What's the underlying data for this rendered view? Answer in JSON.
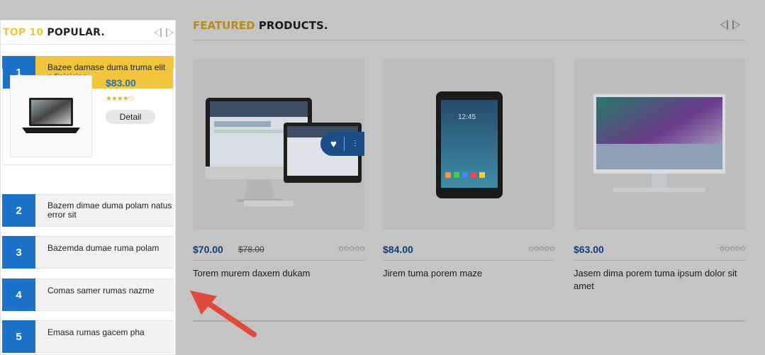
{
  "popular": {
    "title_accent": "TOP 10",
    "title_main": "POPULAR.",
    "items": [
      {
        "rank": "1",
        "label": "Bazee damase duma truma elit adipisicing"
      },
      {
        "rank": "2",
        "label": "Bazem dimae duma polam natus error sit"
      },
      {
        "rank": "3",
        "label": "Bazemda dumae ruma polam"
      },
      {
        "rank": "4",
        "label": "Comas samer rumas nazme"
      },
      {
        "rank": "5",
        "label": "Emasa rumas gacem pha"
      }
    ],
    "active": {
      "price": "$83.00",
      "stars": "★★★★✩",
      "detail_label": "Detail"
    }
  },
  "featured": {
    "title_accent": "FEATURED",
    "title_main": "PRODUCTS.",
    "products": [
      {
        "price": "$70.00",
        "old_price": "$78.00",
        "stars": "✩✩✩✩✩",
        "name": "Torem murem daxem dukam"
      },
      {
        "price": "$84.00",
        "old_price": "",
        "stars": "✩✩✩✩✩",
        "name": "Jirem tuma porem maze"
      },
      {
        "price": "$63.00",
        "old_price": "",
        "stars": "✩✩✩✩✩",
        "name": "Jasem dima porem tuma ipsum dolor sit amet"
      }
    ]
  },
  "colors": {
    "accent_yellow": "#f2c63c",
    "brand_blue": "#1b73c9",
    "overlay_gray": "#c4c4c4",
    "annotation_red": "#e04a3a"
  }
}
